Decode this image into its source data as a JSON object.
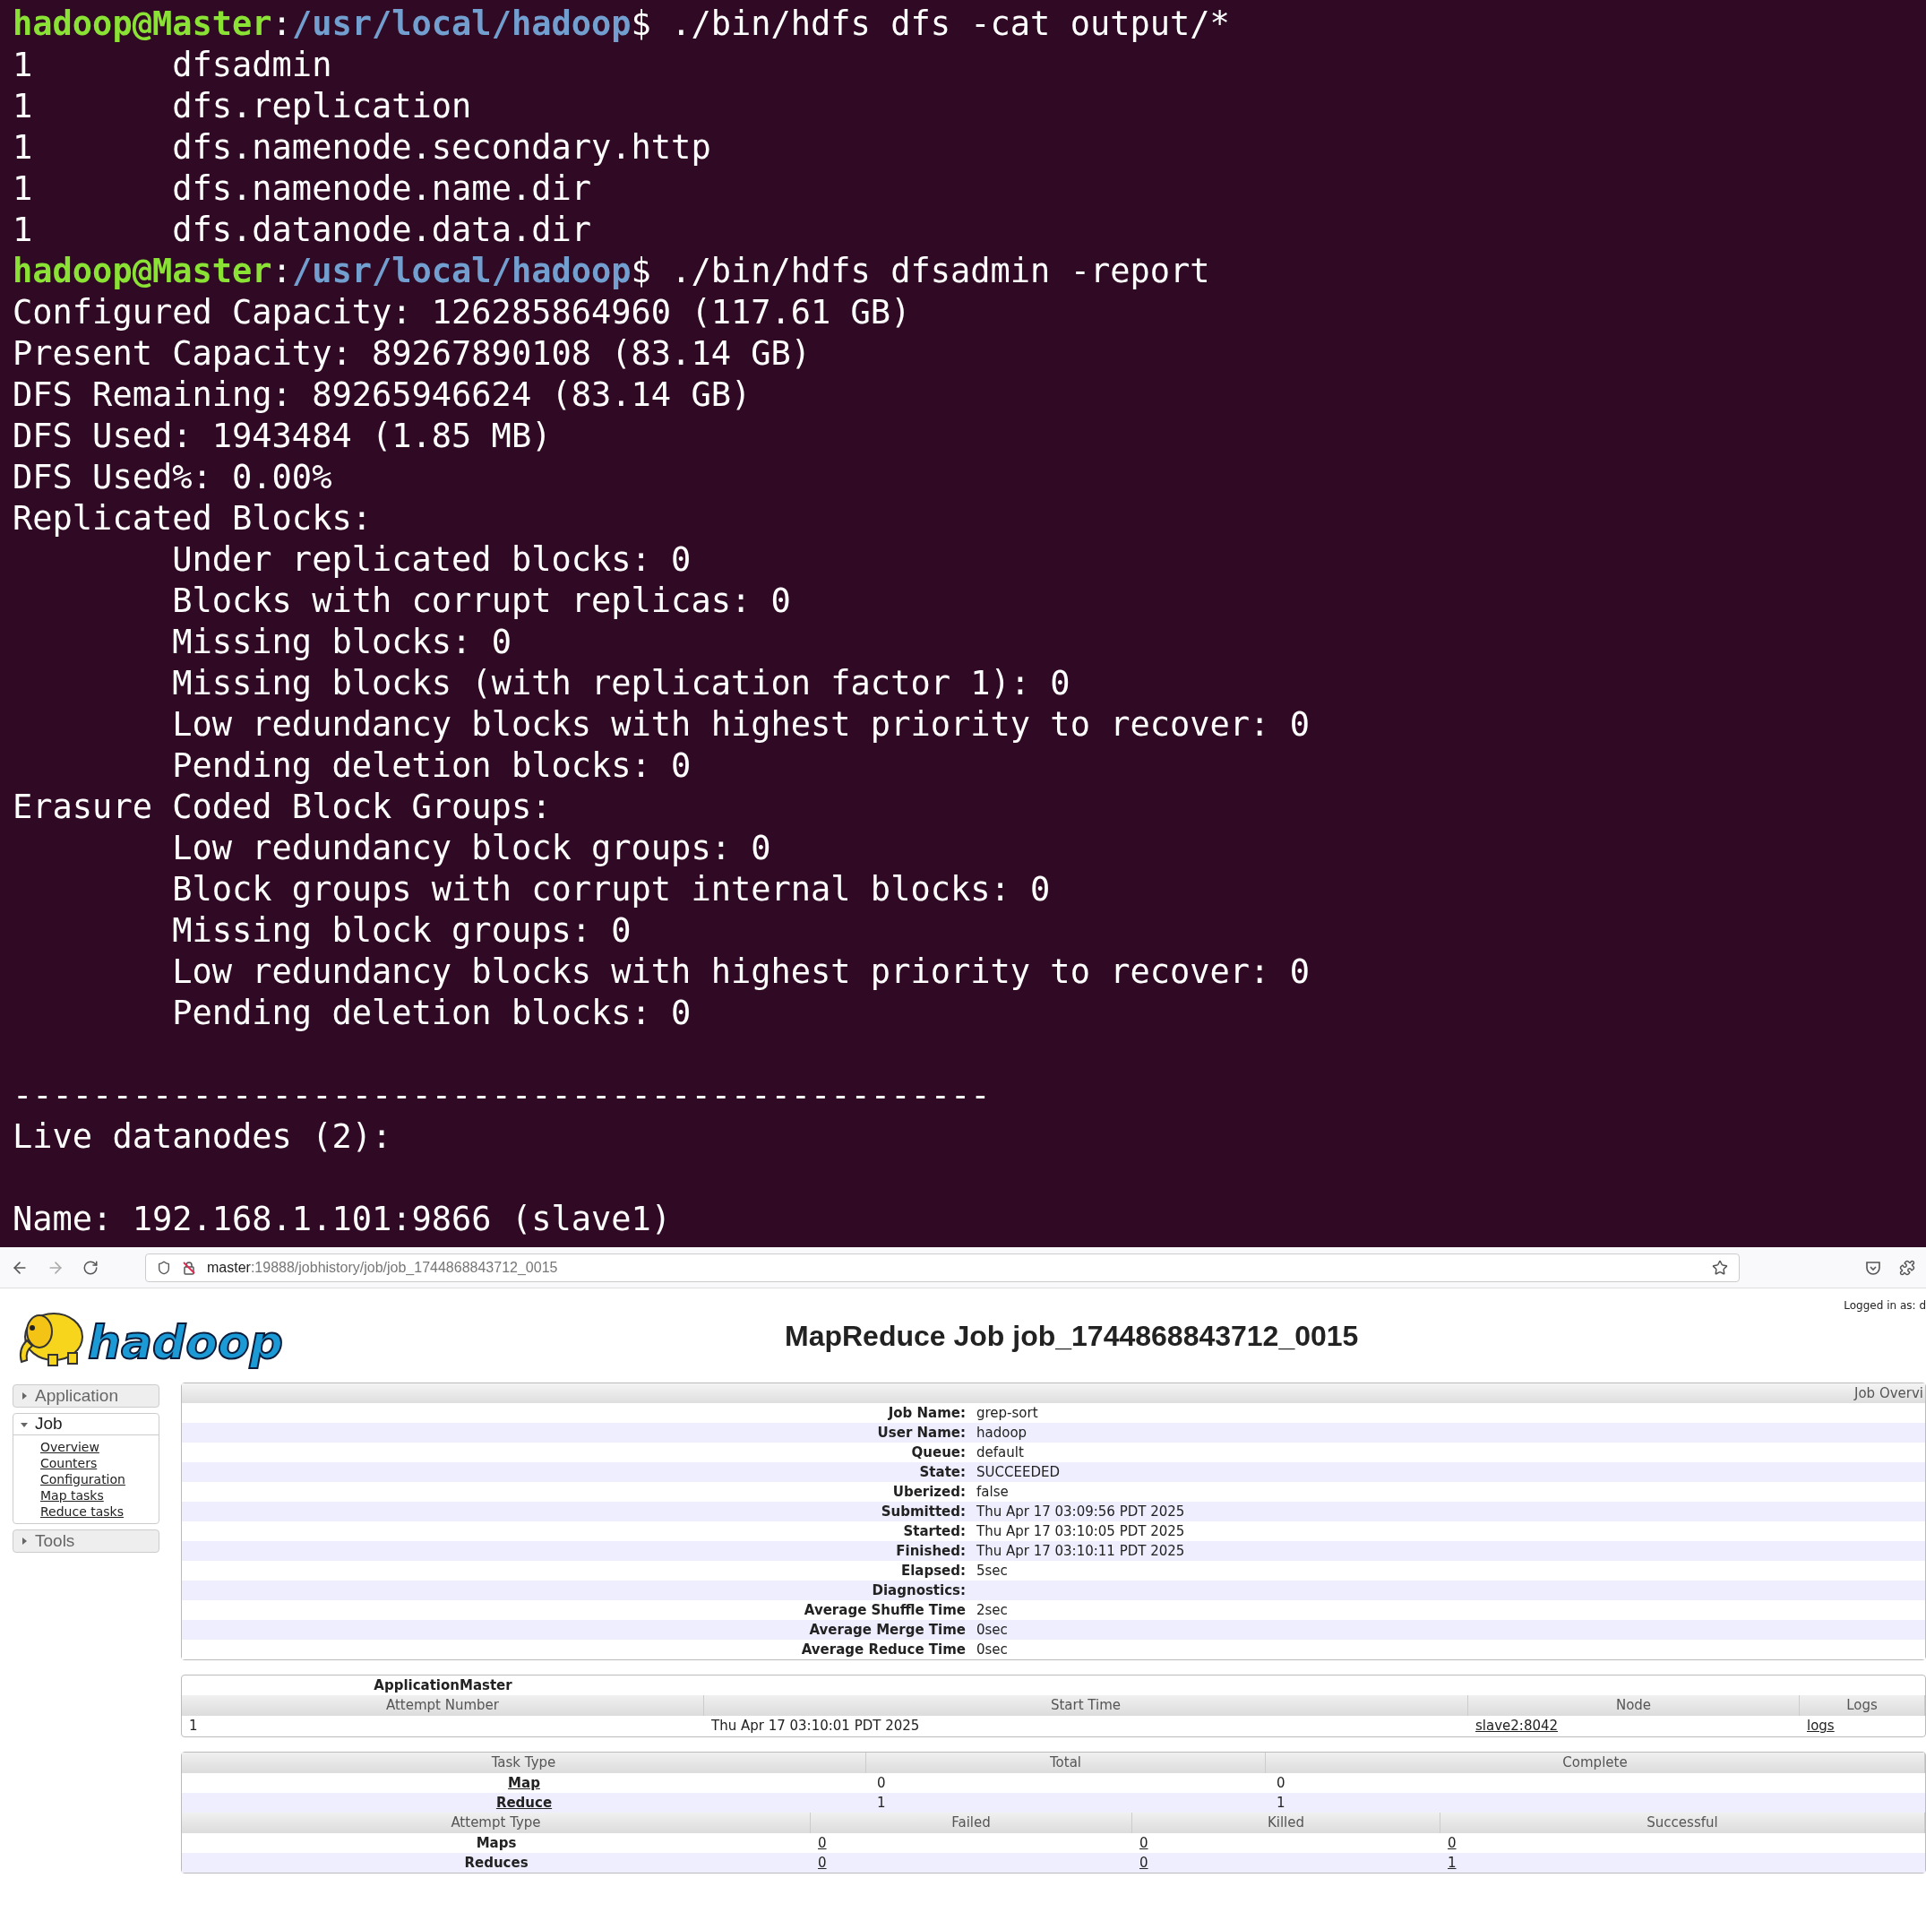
{
  "terminal": {
    "lines": [
      {
        "kind": "prompt",
        "user": "hadoop@Master",
        "separator": ":",
        "path": "/usr/local/hadoop",
        "suffix": "$",
        "command": " ./bin/hdfs dfs -cat output/*"
      },
      {
        "kind": "output",
        "text": "1\tdfsadmin"
      },
      {
        "kind": "output",
        "text": "1\tdfs.replication"
      },
      {
        "kind": "output",
        "text": "1\tdfs.namenode.secondary.http"
      },
      {
        "kind": "output",
        "text": "1\tdfs.namenode.name.dir"
      },
      {
        "kind": "output",
        "text": "1\tdfs.datanode.data.dir"
      },
      {
        "kind": "prompt",
        "user": "hadoop@Master",
        "separator": ":",
        "path": "/usr/local/hadoop",
        "suffix": "$",
        "command": " ./bin/hdfs dfsadmin -report"
      },
      {
        "kind": "output",
        "text": "Configured Capacity: 126285864960 (117.61 GB)"
      },
      {
        "kind": "output",
        "text": "Present Capacity: 89267890108 (83.14 GB)"
      },
      {
        "kind": "output",
        "text": "DFS Remaining: 89265946624 (83.14 GB)"
      },
      {
        "kind": "output",
        "text": "DFS Used: 1943484 (1.85 MB)"
      },
      {
        "kind": "output",
        "text": "DFS Used%: 0.00%"
      },
      {
        "kind": "output",
        "text": "Replicated Blocks:"
      },
      {
        "kind": "output",
        "text": "\tUnder replicated blocks: 0"
      },
      {
        "kind": "output",
        "text": "\tBlocks with corrupt replicas: 0"
      },
      {
        "kind": "output",
        "text": "\tMissing blocks: 0"
      },
      {
        "kind": "output",
        "text": "\tMissing blocks (with replication factor 1): 0"
      },
      {
        "kind": "output",
        "text": "\tLow redundancy blocks with highest priority to recover: 0"
      },
      {
        "kind": "output",
        "text": "\tPending deletion blocks: 0"
      },
      {
        "kind": "output",
        "text": "Erasure Coded Block Groups:"
      },
      {
        "kind": "output",
        "text": "\tLow redundancy block groups: 0"
      },
      {
        "kind": "output",
        "text": "\tBlock groups with corrupt internal blocks: 0"
      },
      {
        "kind": "output",
        "text": "\tMissing block groups: 0"
      },
      {
        "kind": "output",
        "text": "\tLow redundancy blocks with highest priority to recover: 0"
      },
      {
        "kind": "output",
        "text": "\tPending deletion blocks: 0"
      },
      {
        "kind": "blank"
      },
      {
        "kind": "output",
        "text": "-------------------------------------------------"
      },
      {
        "kind": "output",
        "text": "Live datanodes (2):"
      },
      {
        "kind": "blank"
      },
      {
        "kind": "output",
        "text": "Name: 192.168.1.101:9866 (slave1)"
      }
    ]
  },
  "browser": {
    "url_host": "master",
    "url_path": ":19888/jobhistory/job/job_1744868843712_0015"
  },
  "page": {
    "logo_text": "hadoop",
    "title": "MapReduce Job job_1744868843712_0015",
    "login": "Logged in as: d"
  },
  "sidebar": [
    {
      "label": "Application",
      "expanded": false
    },
    {
      "label": "Job",
      "expanded": true,
      "children": [
        "Overview",
        "Counters",
        "Configuration",
        "Map tasks",
        "Reduce tasks"
      ]
    },
    {
      "label": "Tools",
      "expanded": false
    }
  ],
  "overview": {
    "heading": "Job Overvi",
    "rows": [
      {
        "label": "Job Name:",
        "value": "grep-sort"
      },
      {
        "label": "User Name:",
        "value": "hadoop"
      },
      {
        "label": "Queue:",
        "value": "default"
      },
      {
        "label": "State:",
        "value": "SUCCEEDED"
      },
      {
        "label": "Uberized:",
        "value": "false"
      },
      {
        "label": "Submitted:",
        "value": "Thu Apr 17 03:09:56 PDT 2025"
      },
      {
        "label": "Started:",
        "value": "Thu Apr 17 03:10:05 PDT 2025"
      },
      {
        "label": "Finished:",
        "value": "Thu Apr 17 03:10:11 PDT 2025"
      },
      {
        "label": "Elapsed:",
        "value": "5sec"
      },
      {
        "label": "Diagnostics:"
      },
      {
        "label": "Average Shuffle Time",
        "value": "2sec"
      },
      {
        "label": "Average Merge Time",
        "value": "0sec"
      },
      {
        "label": "Average Reduce Time",
        "value": "0sec"
      }
    ]
  },
  "app_master": {
    "title": "ApplicationMaster",
    "columns": [
      "Attempt Number",
      "Start Time",
      "Node",
      "Logs"
    ],
    "rows": [
      [
        {
          "text": "1",
          "link": false
        },
        {
          "text": "Thu Apr 17 03:10:01 PDT 2025",
          "link": false
        },
        {
          "text": "slave2:8042",
          "link": true
        },
        {
          "text": "logs",
          "link": true
        }
      ]
    ]
  },
  "tasks": {
    "columns": [
      "Task Type",
      "Total",
      "Complete"
    ],
    "rows": [
      [
        {
          "text": "Map",
          "link": true
        },
        {
          "text": "0",
          "link": false
        },
        {
          "text": "0",
          "link": false
        }
      ],
      [
        {
          "text": "Reduce",
          "link": true
        },
        {
          "text": "1",
          "link": false
        },
        {
          "text": "1",
          "link": false
        }
      ]
    ]
  },
  "attempts": {
    "columns": [
      "Attempt Type",
      "Failed",
      "Killed",
      "Successful"
    ],
    "rows": [
      [
        {
          "text": "Maps",
          "link": false
        },
        {
          "text": "0",
          "link": true
        },
        {
          "text": "0",
          "link": true
        },
        {
          "text": "0",
          "link": true
        }
      ],
      [
        {
          "text": "Reduces",
          "link": false
        },
        {
          "text": "0",
          "link": true
        },
        {
          "text": "0",
          "link": true
        },
        {
          "text": "1",
          "link": true
        }
      ]
    ]
  }
}
